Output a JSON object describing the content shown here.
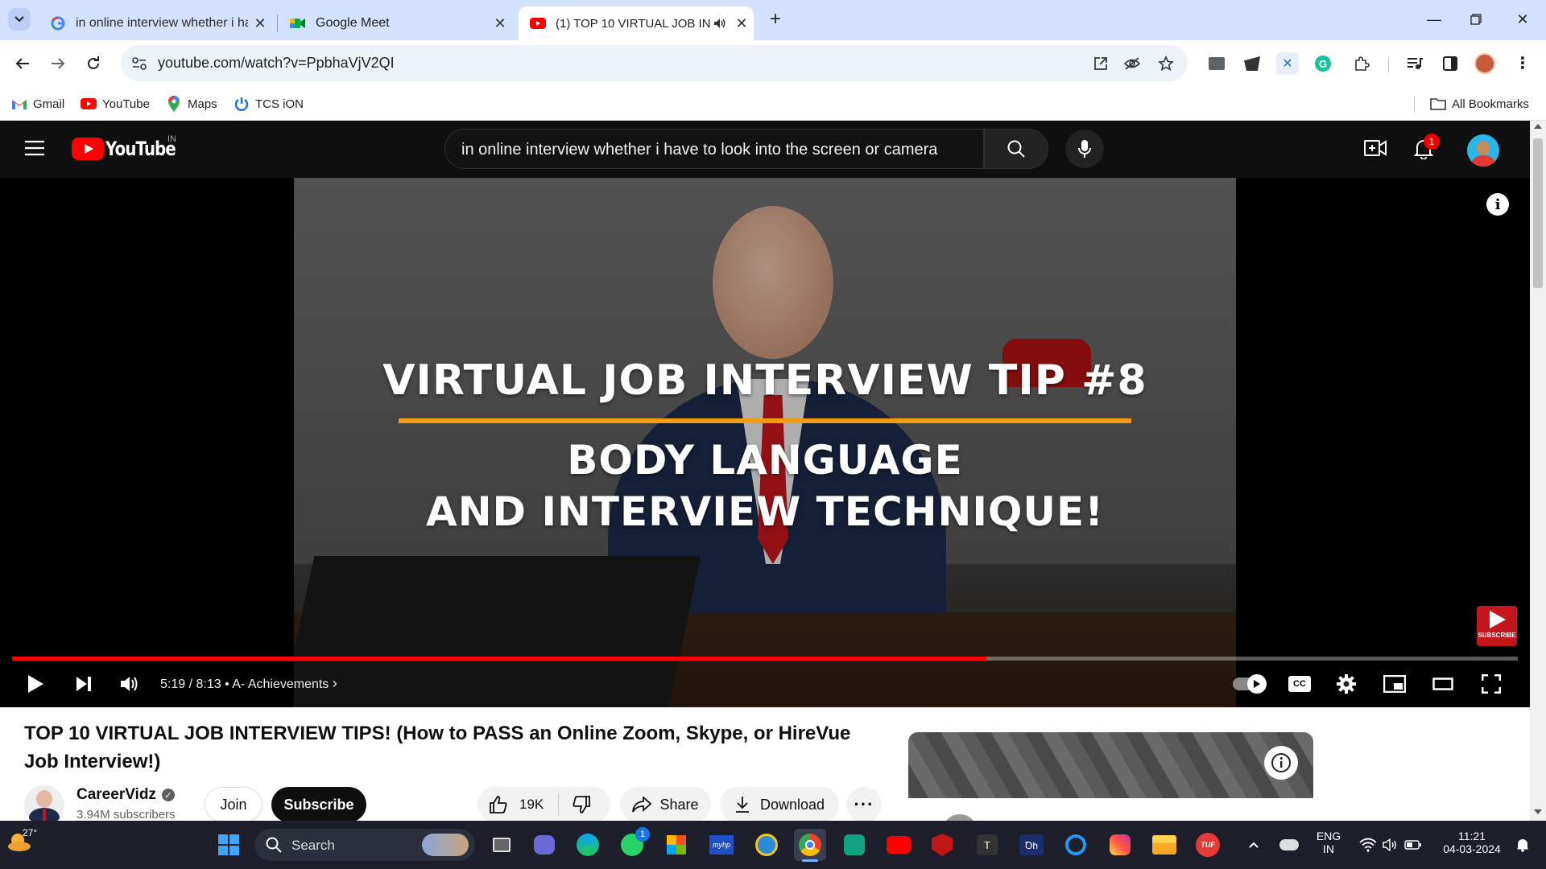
{
  "browser": {
    "tabs": [
      {
        "title": "in online interview whether i ha",
        "icon": "google-g-icon",
        "active": false
      },
      {
        "title": "Google Meet",
        "icon": "google-meet-icon",
        "active": false
      },
      {
        "title": "(1) TOP 10 VIRTUAL JOB INT",
        "icon": "youtube-icon",
        "active": true,
        "audio": true
      }
    ],
    "url": "youtube.com/watch?v=PpbhaVjV2QI",
    "bookmarks": [
      {
        "label": "Gmail",
        "icon": "gmail-icon"
      },
      {
        "label": "YouTube",
        "icon": "youtube-icon"
      },
      {
        "label": "Maps",
        "icon": "maps-pin-icon"
      },
      {
        "label": "TCS iON",
        "icon": "power-icon"
      }
    ],
    "all_bookmarks_label": "All Bookmarks"
  },
  "youtube": {
    "logo_text": "YouTube",
    "region": "IN",
    "search_query": "in online interview whether i have to look into the screen or camera",
    "notification_count": "1",
    "player": {
      "overlay_line1": "VIRTUAL JOB INTERVIEW TIP #8",
      "overlay_line2": "BODY LANGUAGE",
      "overlay_line3": "AND INTERVIEW TECHNIQUE!",
      "time_current": "5:19",
      "time_total": "8:13",
      "time_display": "5:19 / 8:13",
      "chapter": "A- Achievements",
      "progress": 0.647,
      "subscribe_watermark": "SUBSCRIBE"
    },
    "video_title": "TOP 10 VIRTUAL JOB INTERVIEW TIPS! (How to PASS an Online Zoom, Skype, or HireVue Job Interview!)",
    "channel": {
      "name": "CareerVidz",
      "subscribers": "3.94M subscribers",
      "join_label": "Join",
      "subscribe_label": "Subscribe"
    },
    "actions": {
      "likes": "19K",
      "share_label": "Share",
      "download_label": "Download"
    }
  },
  "taskbar": {
    "weather_temp": "27°",
    "search_placeholder": "Search",
    "whatsapp_badge": "1",
    "lang_line1": "ENG",
    "lang_line2": "IN",
    "time": "11:21",
    "date": "04-03-2024"
  },
  "colors": {
    "tabstrip": "#d3e3fd",
    "yt_red": "#ff0000",
    "masthead": "#0f0f0f",
    "taskbar": "#1c1f2a"
  }
}
